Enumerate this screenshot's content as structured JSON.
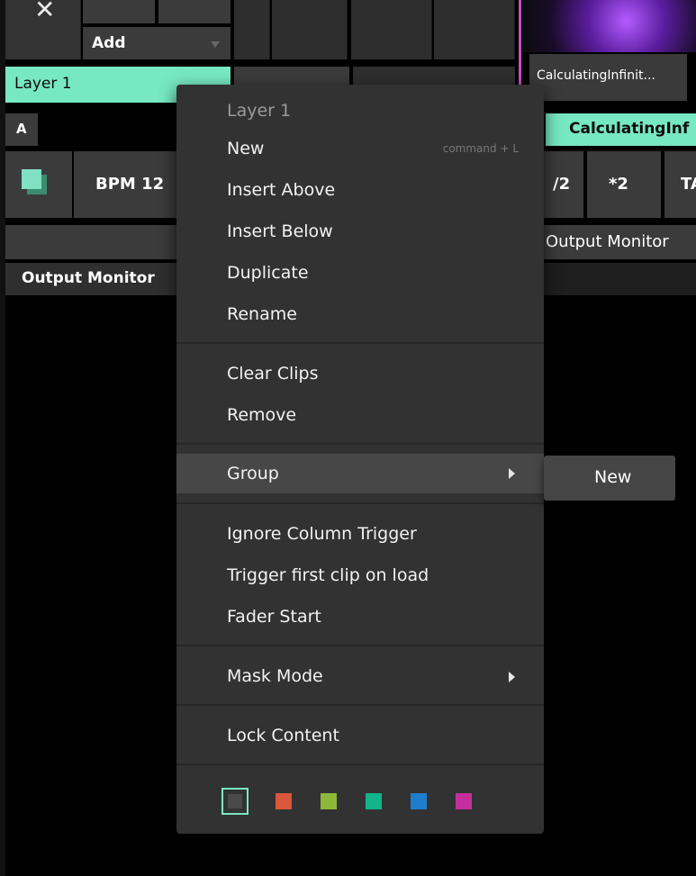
{
  "app": {
    "close_glyph": "✕",
    "add_label": "Add",
    "layer_label": "Layer 1",
    "layer_color": "#77e8c2",
    "ab_label": "A    B",
    "clip_thumb_label": "CalculatingInfinit...",
    "clip_border_color": "#c94cc7",
    "a_label": "A",
    "clip_tab_label": "CalculatingInf",
    "bpm_label": "BPM  12",
    "div2_label": "/2",
    "mul2_label": "*2",
    "tap_label": "TA",
    "output_monitor_right": "Output Monitor",
    "output_monitor_title": "Output Monitor"
  },
  "context_menu": {
    "header": "Layer 1",
    "items": [
      {
        "label": "New",
        "shortcut": "command + L"
      },
      {
        "label": "Insert Above"
      },
      {
        "label": "Insert Below"
      },
      {
        "label": "Duplicate"
      },
      {
        "label": "Rename"
      },
      {
        "label": "Clear Clips"
      },
      {
        "label": "Remove"
      },
      {
        "label": "Group",
        "submenu": true,
        "highlighted": true
      },
      {
        "label": "Ignore Column Trigger"
      },
      {
        "label": "Trigger first clip on load"
      },
      {
        "label": "Fader Start"
      },
      {
        "label": "Mask Mode",
        "submenu": true
      },
      {
        "label": "Lock Content"
      }
    ],
    "colors": [
      {
        "name": "none",
        "hex": "#4a4a4a",
        "selected": true
      },
      {
        "name": "red",
        "hex": "#d9573a"
      },
      {
        "name": "green",
        "hex": "#8db83a"
      },
      {
        "name": "teal",
        "hex": "#12b58a"
      },
      {
        "name": "blue",
        "hex": "#1f7ecb"
      },
      {
        "name": "magenta",
        "hex": "#c42f9c"
      }
    ]
  },
  "group_submenu": {
    "items": [
      {
        "label": "New"
      }
    ]
  }
}
